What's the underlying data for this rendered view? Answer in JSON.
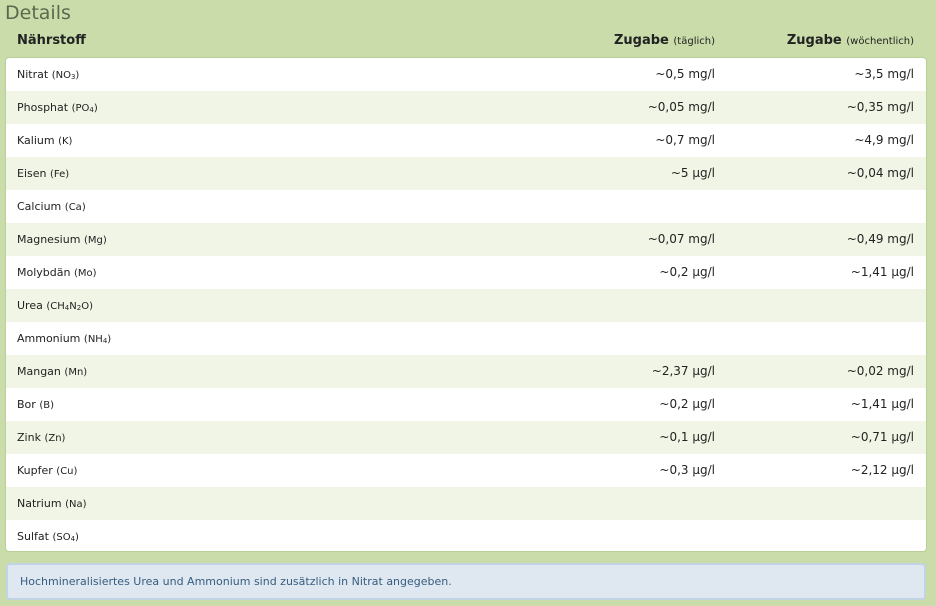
{
  "section": {
    "title": "Details"
  },
  "table": {
    "headers": {
      "name": "Nährstoff",
      "daily": "Zugabe",
      "daily_note": "(täglich)",
      "weekly": "Zugabe",
      "weekly_note": "(wöchentlich)"
    },
    "rows": [
      {
        "name": "Nitrat",
        "formula_parts": [
          "NO",
          "3",
          ""
        ],
        "daily": "~0,5 mg/l",
        "weekly": "~3,5 mg/l"
      },
      {
        "name": "Phosphat",
        "formula_parts": [
          "PO",
          "4",
          ""
        ],
        "daily": "~0,05 mg/l",
        "weekly": "~0,35 mg/l"
      },
      {
        "name": "Kalium",
        "formula_parts": [
          "K",
          "",
          ""
        ],
        "daily": "~0,7 mg/l",
        "weekly": "~4,9 mg/l"
      },
      {
        "name": "Eisen",
        "formula_parts": [
          "Fe",
          "",
          ""
        ],
        "daily": "~5 µg/l",
        "weekly": "~0,04 mg/l"
      },
      {
        "name": "Calcium",
        "formula_parts": [
          "Ca",
          "",
          ""
        ],
        "daily": "",
        "weekly": ""
      },
      {
        "name": "Magnesium",
        "formula_parts": [
          "Mg",
          "",
          ""
        ],
        "daily": "~0,07 mg/l",
        "weekly": "~0,49 mg/l"
      },
      {
        "name": "Molybdän",
        "formula_parts": [
          "Mo",
          "",
          ""
        ],
        "daily": "~0,2 µg/l",
        "weekly": "~1,41 µg/l"
      },
      {
        "name": "Urea",
        "formula_parts": [
          "CH",
          "4",
          "N",
          "2",
          "O"
        ],
        "daily": "",
        "weekly": ""
      },
      {
        "name": "Ammonium",
        "formula_parts": [
          "NH",
          "4",
          ""
        ],
        "daily": "",
        "weekly": ""
      },
      {
        "name": "Mangan",
        "formula_parts": [
          "Mn",
          "",
          ""
        ],
        "daily": "~2,37 µg/l",
        "weekly": "~0,02 mg/l"
      },
      {
        "name": "Bor",
        "formula_parts": [
          "B",
          "",
          ""
        ],
        "daily": "~0,2 µg/l",
        "weekly": "~1,41 µg/l"
      },
      {
        "name": "Zink",
        "formula_parts": [
          "Zn",
          "",
          ""
        ],
        "daily": "~0,1 µg/l",
        "weekly": "~0,71 µg/l"
      },
      {
        "name": "Kupfer",
        "formula_parts": [
          "Cu",
          "",
          ""
        ],
        "daily": "~0,3 µg/l",
        "weekly": "~2,12 µg/l"
      },
      {
        "name": "Natrium",
        "formula_parts": [
          "Na",
          "",
          ""
        ],
        "daily": "",
        "weekly": ""
      },
      {
        "name": "Sulfat",
        "formula_parts": [
          "SO",
          "4",
          ""
        ],
        "daily": "",
        "weekly": ""
      }
    ]
  },
  "note": {
    "text": "Hochmineralisiertes Urea und Ammonium sind zusätzlich in Nitrat angegeben."
  },
  "colors": {
    "page_background": "#c9dcaa",
    "row_alt": "#f1f5e6",
    "note_background": "#dfe8f1",
    "note_text": "#355d80"
  }
}
